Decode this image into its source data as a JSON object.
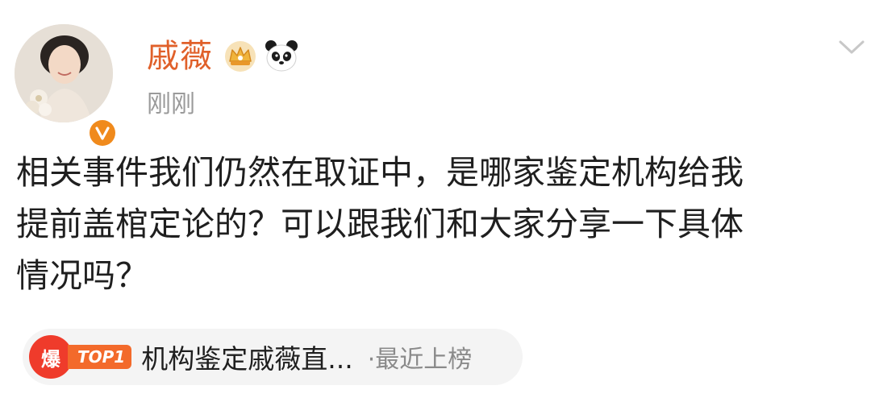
{
  "post": {
    "author": {
      "name": "戚薇",
      "avatar_icon": "avatar-photo",
      "verified_icon": "verified-v-icon",
      "badge_icons": [
        "crown-icon",
        "panda-icon"
      ]
    },
    "timestamp": "刚刚",
    "menu_icon": "chevron-down-icon",
    "text_lines": [
      "相关事件我们仍然在取证中，是哪家鉴定机构给我",
      "提前盖棺定论的？可以跟我们和大家分享一下具体",
      "情况吗？"
    ]
  },
  "hot_topic": {
    "badge": "爆",
    "rank_tag": "TOP1",
    "title": "机构鉴定戚薇直...",
    "meta": "·最近上榜"
  },
  "colors": {
    "username": "#e0602a",
    "timestamp": "#9a9a9a",
    "verified": "#f08a1c",
    "hot_badge": "#ef3b2b",
    "rank_tag": "#f36a2b"
  }
}
